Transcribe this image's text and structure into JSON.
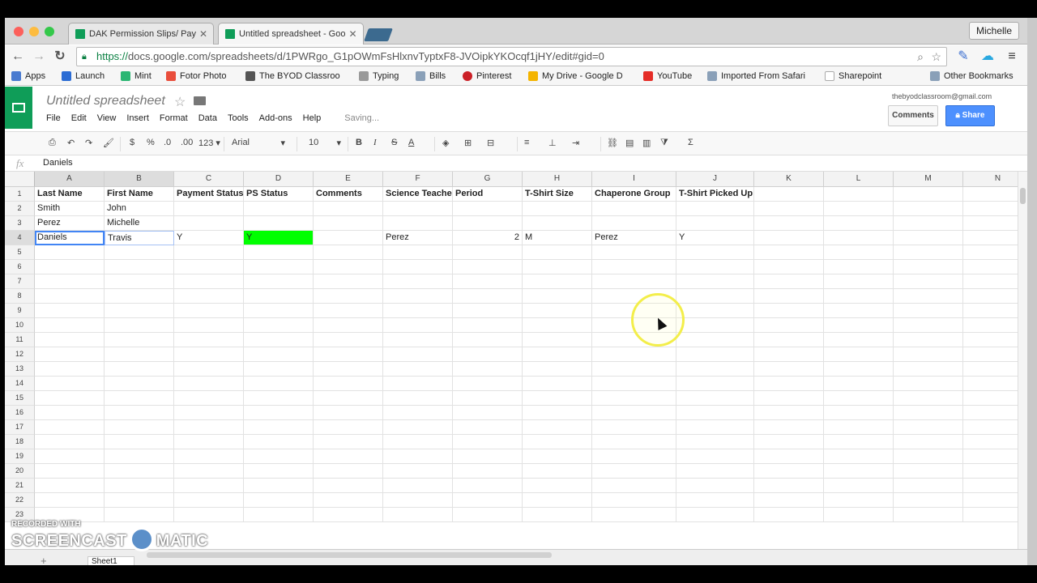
{
  "browser": {
    "tabs": [
      {
        "label": "DAK Permission Slips/ Pay",
        "active": false
      },
      {
        "label": "Untitled spreadsheet - Goo",
        "active": true
      }
    ],
    "user": "Michelle",
    "url_scheme": "https://",
    "url_rest": "docs.google.com/spreadsheets/d/1PWRgo_G1pOWmFsHlxnvTyptxF8-JVOipkYKOcqf1jHY/edit#gid=0",
    "bookmarks": [
      {
        "label": "Apps",
        "color": "#4a7bd0"
      },
      {
        "label": "Launch",
        "color": "#2b6cd4"
      },
      {
        "label": "Mint",
        "color": "#2bb673"
      },
      {
        "label": "Fotor Photo",
        "color": "#e94e3c"
      },
      {
        "label": "The BYOD Classroo",
        "color": "#555555"
      },
      {
        "label": "Typing",
        "color": "#999999"
      },
      {
        "label": "Bills",
        "color": "#8aa0b8"
      },
      {
        "label": "Pinterest",
        "color": "#cb2027"
      },
      {
        "label": "My Drive - Google D",
        "color": "#f4b400"
      },
      {
        "label": "YouTube",
        "color": "#e52d27"
      },
      {
        "label": "Imported From Safari",
        "color": "#8aa0b8"
      },
      {
        "label": "Sharepoint",
        "color": "#cccccc"
      },
      {
        "label": "Other Bookmarks",
        "color": "#8aa0b8"
      }
    ]
  },
  "sheets": {
    "title": "Untitled spreadsheet",
    "account": "thebyodclassroom@gmail.com",
    "comments_label": "Comments",
    "share_label": "Share",
    "menus": [
      "File",
      "Edit",
      "View",
      "Insert",
      "Format",
      "Data",
      "Tools",
      "Add-ons",
      "Help"
    ],
    "status": "Saving...",
    "toolbar": {
      "currency": "$",
      "percent": "%",
      "dec_less": ".0",
      "dec_more": ".00",
      "format_more": "123",
      "font": "Arial",
      "font_size": "10",
      "bold": "B",
      "italic": "I",
      "strike": "S",
      "text_color": "A",
      "sum": "Σ"
    },
    "formula_bar": {
      "fx": "fx",
      "value": "Daniels"
    },
    "columns": [
      "A",
      "B",
      "C",
      "D",
      "E",
      "F",
      "G",
      "H",
      "I",
      "J",
      "K",
      "L",
      "M",
      "N"
    ],
    "rows": [
      [
        "Last Name",
        "First Name",
        "Payment Status",
        "PS Status",
        "Comments",
        "Science Teacher",
        "Period",
        "T-Shirt Size",
        "Chaperone Group",
        "T-Shirt Picked Up",
        "",
        "",
        "",
        ""
      ],
      [
        "Smith",
        "John",
        "",
        "",
        "",
        "",
        "",
        "",
        "",
        "",
        "",
        "",
        "",
        ""
      ],
      [
        "Perez",
        "Michelle",
        "",
        "",
        "",
        "",
        "",
        "",
        "",
        "",
        "",
        "",
        "",
        ""
      ],
      [
        "Daniels",
        "Travis",
        "Y",
        "Y",
        "",
        "Perez",
        "2",
        "M",
        "Perez",
        "Y",
        "",
        "",
        "",
        ""
      ]
    ],
    "row_count": 23,
    "sheet_tab": "Sheet1",
    "highlight_color": "#00ff00"
  },
  "watermark": {
    "line1": "RECORDED WITH",
    "line2a": "SCREENCAST",
    "line2b": "MATIC"
  }
}
